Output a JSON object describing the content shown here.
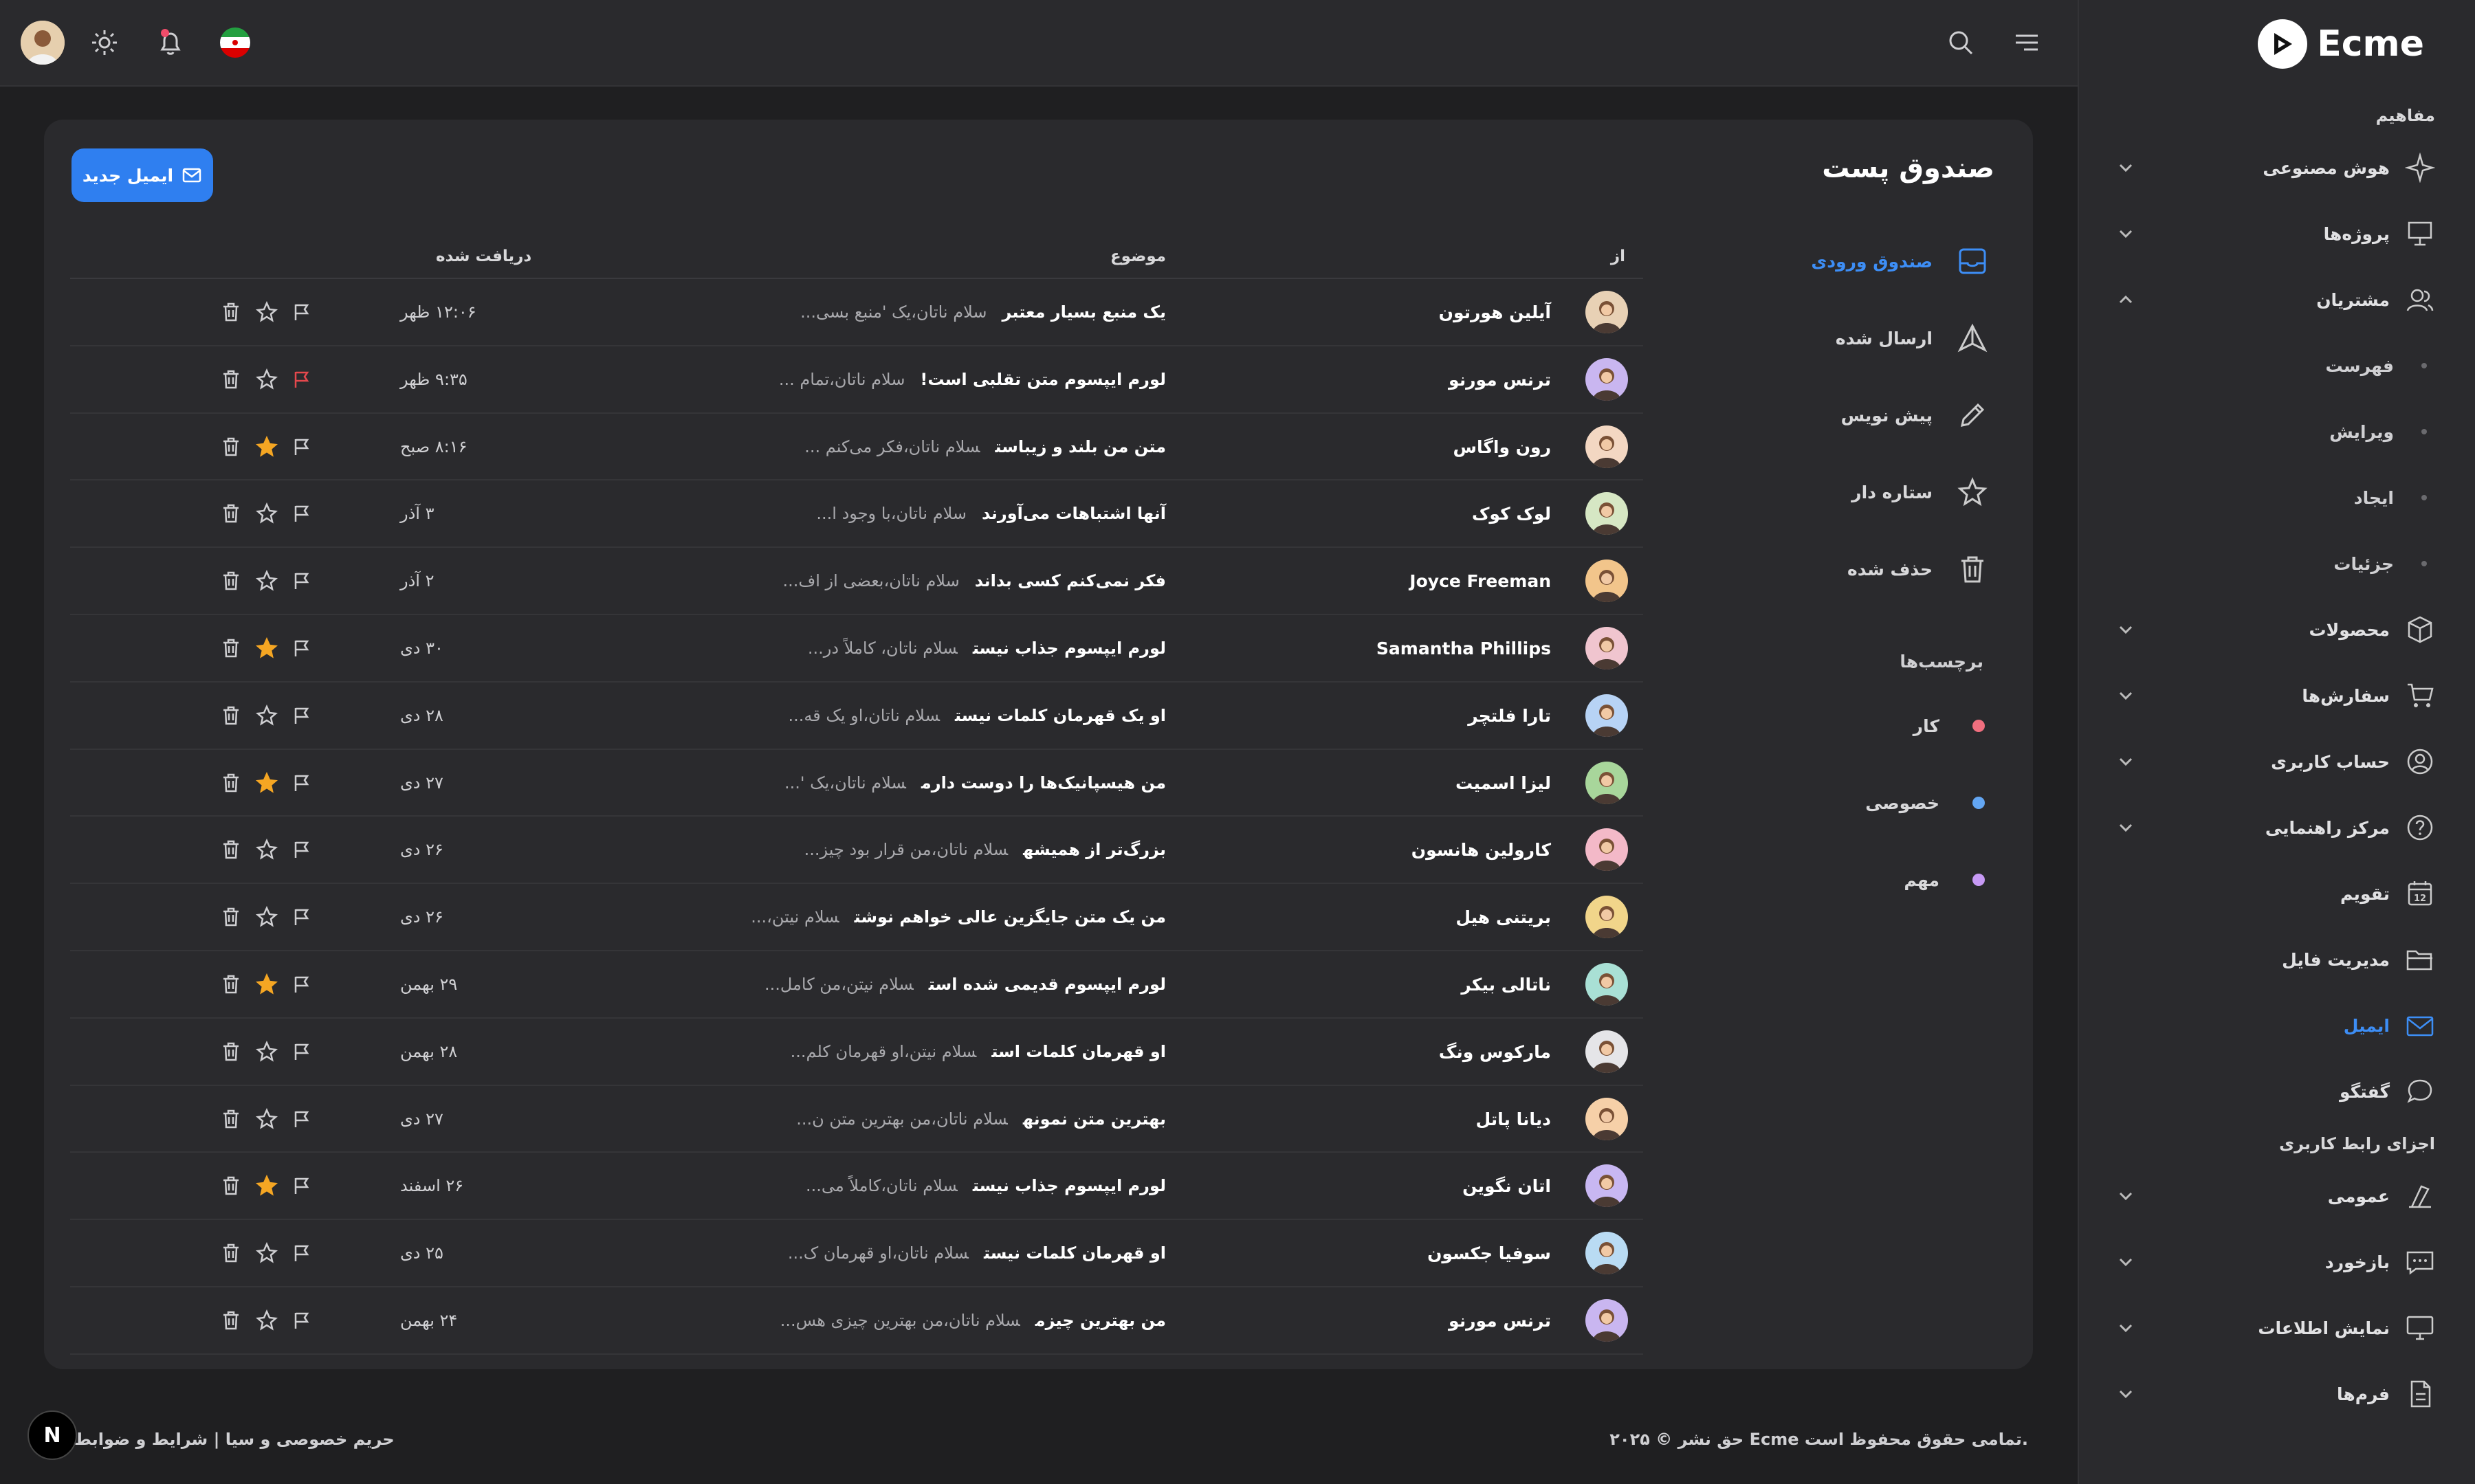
{
  "app": {
    "logo": "Ecme"
  },
  "sidebar": {
    "section_concepts": "مفاهیم",
    "section_ui": "اجزای رابط کاربری",
    "items": [
      {
        "label": "هوش مصنوعی",
        "icon": "sparkle-icon"
      },
      {
        "label": "پروژه‌ها",
        "icon": "presentation-icon"
      },
      {
        "label": "مشتریان",
        "icon": "users-icon"
      },
      {
        "label": "فهرست"
      },
      {
        "label": "ویرایش"
      },
      {
        "label": "ایجاد"
      },
      {
        "label": "جزئیات"
      },
      {
        "label": "محصولات",
        "icon": "box-icon"
      },
      {
        "label": "سفارش‌ها",
        "icon": "cart-icon"
      },
      {
        "label": "حساب کاربری",
        "icon": "user-circle-icon"
      },
      {
        "label": "مرکز راهنمایی",
        "icon": "help-icon"
      },
      {
        "label": "تقویم",
        "icon": "calendar-icon"
      },
      {
        "label": "مدیریت فایل",
        "icon": "folder-icon"
      },
      {
        "label": "ایمیل",
        "icon": "mail-icon"
      },
      {
        "label": "گفتگو",
        "icon": "chat-icon"
      },
      {
        "label": "عمومی",
        "icon": "shapes-icon"
      },
      {
        "label": "بازخورد",
        "icon": "feedback-icon"
      },
      {
        "label": "نمایش اطلاعات",
        "icon": "monitor-icon"
      },
      {
        "label": "فرم‌ها",
        "icon": "form-icon"
      }
    ],
    "calendar_day": "12"
  },
  "mail": {
    "title": "صندوق پست",
    "new_button": "ایمیل جدید",
    "folders": [
      {
        "label": "صندوق ورودی",
        "icon": "inbox-icon"
      },
      {
        "label": "ارسال شده",
        "icon": "send-icon"
      },
      {
        "label": "پیش نویس",
        "icon": "pencil-icon"
      },
      {
        "label": "ستاره دار",
        "icon": "star-icon"
      },
      {
        "label": "حذف شده",
        "icon": "trash-icon"
      }
    ],
    "labels_title": "برچسب‌ها",
    "labels": [
      {
        "label": "کار",
        "color": "#f16f7f"
      },
      {
        "label": "خصوصی",
        "color": "#63a6f3"
      },
      {
        "label": "مهم",
        "color": "#c79af5"
      }
    ],
    "columns": {
      "from": "از",
      "subject": "موضوع",
      "received": "دریافت شده"
    },
    "rows": [
      {
        "name": "آیلین هورتون",
        "subject": "یک منبع بسیار معتبر",
        "preview": "سلام ناتان،یک 'منبع بسی...",
        "date": "۱۲:۰۶ ظهر",
        "starred": false,
        "flagged": false,
        "avatar_color": "#e8d1b5"
      },
      {
        "name": "ترنس مورنو",
        "subject": "لورم ایپسوم متن تقلبی است!",
        "preview": "سلام ناتان،تمام ...",
        "date": "۹:۳۵ ظهر",
        "starred": false,
        "flagged": true,
        "avatar_color": "#c9b6f0"
      },
      {
        "name": "رون واگاس",
        "subject": "متن من بلند و زیباست",
        "preview": "سلام ناتان،فکر می‌کنم ...",
        "date": "۸:۱۶ صبح",
        "starred": true,
        "flagged": false,
        "avatar_color": "#f3d7c2"
      },
      {
        "name": "لوک کوک",
        "subject": "آنها اشتباهات می‌آورند",
        "preview": "سلام ناتان،با وجود ا...",
        "date": "۳ آذر",
        "starred": false,
        "flagged": false,
        "avatar_color": "#d6e7c4"
      },
      {
        "name": "Joyce Freeman",
        "subject": "فکر نمی‌کنم کسی بداند",
        "preview": "سلام ناتان،بعضی از اف...",
        "date": "۲ آذر",
        "starred": false,
        "flagged": false,
        "avatar_color": "#f2c58b"
      },
      {
        "name": "Samantha Phillips",
        "subject": "لورم ایپسوم جذاب نیست",
        "preview": "سلام ناتان، کاملاً در...",
        "date": "۳۰ دی",
        "starred": true,
        "flagged": false,
        "avatar_color": "#f0c5cf"
      },
      {
        "name": "تارا فلتچر",
        "subject": "او یک قهرمان کلمات نیست",
        "preview": "سلام ناتان،او یک قه...",
        "date": "۲۸ دی",
        "starred": false,
        "flagged": false,
        "avatar_color": "#b7d3f5"
      },
      {
        "name": "لیزا اسمیت",
        "subject": "من هیسپانیک‌ها را دوست دارم",
        "preview": "سلام ناتان،یک '...",
        "date": "۲۷ دی",
        "starred": true,
        "flagged": false,
        "avatar_color": "#a8d69b"
      },
      {
        "name": "کارولین هانسون",
        "subject": "بزرگ‌تر از همیشه",
        "preview": "سلام ناتان،من قرار بود چیز...",
        "date": "۲۶ دی",
        "starred": false,
        "flagged": false,
        "avatar_color": "#f3b9c8"
      },
      {
        "name": "بریتنی هیل",
        "subject": "من یک متن جایگزین عالی خواهم نوشت",
        "preview": "سلام نیتن،...",
        "date": "۲۶ دی",
        "starred": false,
        "flagged": false,
        "avatar_color": "#f1d58a"
      },
      {
        "name": "ناتالی بیکر",
        "subject": "لورم ایپسوم قدیمی شده است",
        "preview": "سلام نیتن،من کامل...",
        "date": "۲۹ بهمن",
        "starred": true,
        "flagged": false,
        "avatar_color": "#a9e0d5"
      },
      {
        "name": "مارکوس ونگ",
        "subject": "او قهرمان کلمات است",
        "preview": "سلام نیتن،او قهرمان کلم...",
        "date": "۲۸ بهمن",
        "starred": false,
        "flagged": false,
        "avatar_color": "#e5e5e8"
      },
      {
        "name": "دیانا پاتل",
        "subject": "بهترین متن نمونه",
        "preview": "سلام ناتان،من بهترین متن ن...",
        "date": "۲۷ دی",
        "starred": false,
        "flagged": false,
        "avatar_color": "#f6d0a8"
      },
      {
        "name": "اتان نگوین",
        "subject": "لورم ایپسوم جذاب نیست",
        "preview": "سلام ناتان،کاملاً می...",
        "date": "۲۶ اسفند",
        "starred": true,
        "flagged": false,
        "avatar_color": "#c8b7f2"
      },
      {
        "name": "سوفیا جکسون",
        "subject": "او قهرمان کلمات نیست",
        "preview": "سلام ناتان،او قهرمان ک...",
        "date": "۲۵ دی",
        "starred": false,
        "flagged": false,
        "avatar_color": "#b9dbf3"
      },
      {
        "name": "ترنس مورنو",
        "subject": "من بهترین چیزم",
        "preview": "سلام ناتان،من بهترین چیزی هس...",
        "date": "۲۴ بهمن",
        "starred": false,
        "flagged": false,
        "avatar_color": "#c9b6f0"
      }
    ]
  },
  "footer": {
    "copyright": "حق نشر © ۲۰۲۵ Ecme تمامی حقوق محفوظ است.",
    "links": "حریم خصوصی و سیا  |  شرایط و ضوابط",
    "badge": "N"
  },
  "colors": {
    "accent": "#3d8ef6",
    "star": "#f5a623",
    "flag_red": "#e5484d",
    "notification": "#f04c6a"
  }
}
